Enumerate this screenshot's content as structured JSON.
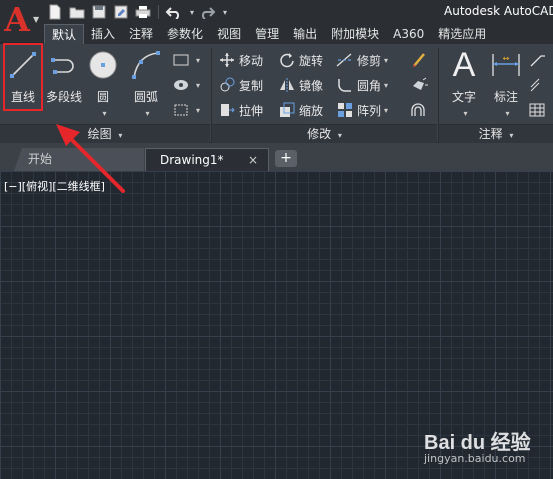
{
  "window": {
    "title": "Autodesk AutoCAD"
  },
  "quick_access": {
    "icons": [
      "new-file-icon",
      "open-folder-icon",
      "save-icon",
      "save-as-icon",
      "print-icon",
      "undo-icon",
      "redo-icon"
    ]
  },
  "ribbon_tabs": [
    {
      "label": "默认",
      "active": true
    },
    {
      "label": "插入"
    },
    {
      "label": "注释"
    },
    {
      "label": "参数化"
    },
    {
      "label": "视图"
    },
    {
      "label": "管理"
    },
    {
      "label": "输出"
    },
    {
      "label": "附加模块"
    },
    {
      "label": "A360"
    },
    {
      "label": "精选应用"
    }
  ],
  "draw_panel": {
    "title": "绘图",
    "tools": {
      "line": "直线",
      "polyline": "多段线",
      "circle": "圆",
      "arc": "圆弧"
    }
  },
  "modify_panel": {
    "title": "修改",
    "tools": {
      "move": "移动",
      "rotate": "旋转",
      "trim": "修剪",
      "copy": "复制",
      "mirror": "镜像",
      "fillet": "圆角",
      "stretch": "拉伸",
      "scale": "缩放",
      "array": "阵列"
    }
  },
  "annotation_panel": {
    "title": "注释",
    "tools": {
      "text": "文字",
      "dimension": "标注"
    }
  },
  "file_tabs": {
    "start": "开始",
    "drawing": "Drawing1*",
    "close_glyph": "×",
    "new_tab_glyph": "+"
  },
  "viewport": {
    "label": "[−][俯视][二维线框]"
  },
  "watermark": {
    "brand": "Bai du 经验",
    "site": "jingyan.baidu.com"
  },
  "colors": {
    "accent_red": "#e5262a",
    "ribbon_bg": "#3b4149",
    "canvas_bg": "#212830"
  }
}
